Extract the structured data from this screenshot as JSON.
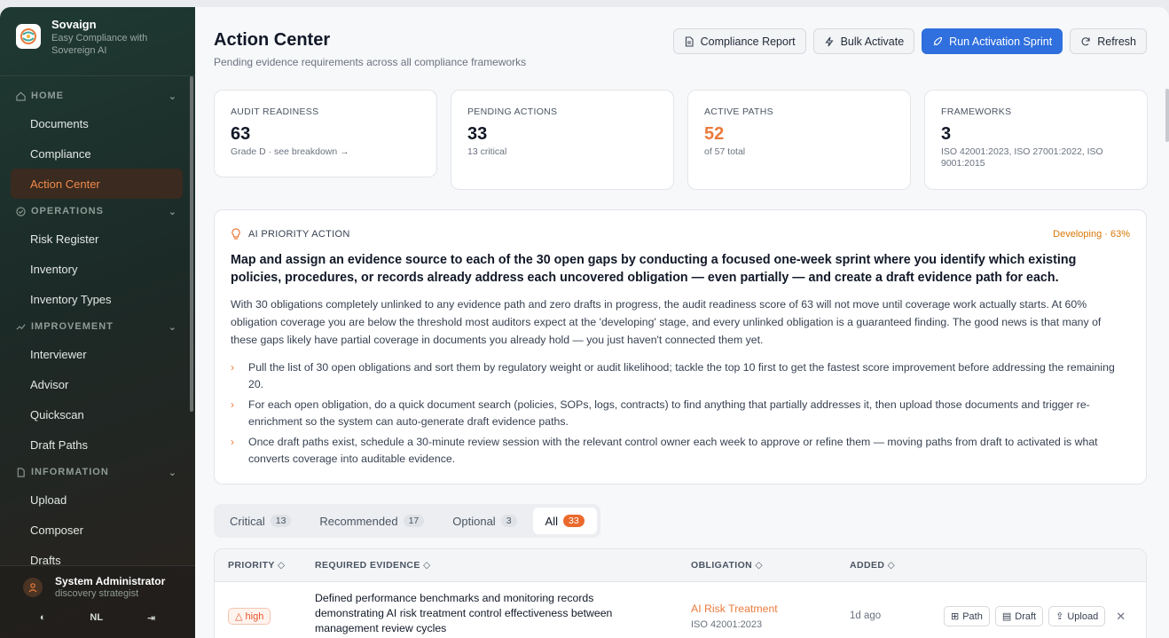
{
  "brand": {
    "name": "Sovaign",
    "tagline": "Easy Compliance with Sovereign AI"
  },
  "sidebar": {
    "sections": [
      {
        "label": "HOME",
        "icon": "home-icon",
        "items": [
          "Documents",
          "Compliance",
          "Action Center"
        ]
      },
      {
        "label": "OPERATIONS",
        "icon": "shield-check-icon",
        "items": [
          "Risk Register",
          "Inventory",
          "Inventory Types"
        ]
      },
      {
        "label": "IMPROVEMENT",
        "icon": "trend-icon",
        "items": [
          "Interviewer",
          "Advisor",
          "Quickscan",
          "Draft Paths"
        ]
      },
      {
        "label": "INFORMATION",
        "icon": "file-icon",
        "items": [
          "Upload",
          "Composer",
          "Drafts"
        ]
      }
    ],
    "active_item": "Action Center",
    "user": {
      "name": "System Administrator",
      "role": "discovery strategist"
    },
    "language": "NL"
  },
  "header": {
    "title": "Action Center",
    "subtitle": "Pending evidence requirements across all compliance frameworks"
  },
  "actions": {
    "report": "Compliance Report",
    "bulk": "Bulk Activate",
    "sprint": "Run Activation Sprint",
    "refresh": "Refresh"
  },
  "stats": [
    {
      "label": "AUDIT READINESS",
      "value": "63",
      "sub": "Grade D · see breakdown →"
    },
    {
      "label": "PENDING ACTIONS",
      "value": "33",
      "sub": "13 critical"
    },
    {
      "label": "ACTIVE PATHS",
      "value": "52",
      "sub": "of 57 total"
    },
    {
      "label": "FRAMEWORKS",
      "value": "3",
      "sub": "ISO 42001:2023, ISO 27001:2022, ISO 9001:2015"
    }
  ],
  "priority": {
    "label": "AI PRIORITY ACTION",
    "status": "Developing · 63%",
    "headline": "Map and assign an evidence source to each of the 30 open gaps by conducting a focused one-week sprint where you identify which existing policies, procedures, or records already address each uncovered obligation — even partially — and create a draft evidence path for each.",
    "body": "With 30 obligations completely unlinked to any evidence path and zero drafts in progress, the audit readiness score of 63 will not move until coverage work actually starts. At 60% obligation coverage you are below the threshold most auditors expect at the 'developing' stage, and every unlinked obligation is a guaranteed finding. The good news is that many of these gaps likely have partial coverage in documents you already hold — you just haven't connected them yet.",
    "steps": [
      "Pull the list of 30 open obligations and sort them by regulatory weight or audit likelihood; tackle the top 10 first to get the fastest score improvement before addressing the remaining 20.",
      "For each open obligation, do a quick document search (policies, SOPs, logs, contracts) to find anything that partially addresses it, then upload those documents and trigger re-enrichment so the system can auto-generate draft evidence paths.",
      "Once draft paths exist, schedule a 30-minute review session with the relevant control owner each week to approve or refine them — moving paths from draft to activated is what converts coverage into auditable evidence."
    ]
  },
  "tabs": [
    {
      "label": "Critical",
      "count": "13"
    },
    {
      "label": "Recommended",
      "count": "17"
    },
    {
      "label": "Optional",
      "count": "3"
    },
    {
      "label": "All",
      "count": "33"
    }
  ],
  "table": {
    "headers": {
      "priority": "PRIORITY",
      "evidence": "REQUIRED EVIDENCE",
      "obligation": "OBLIGATION",
      "added": "ADDED"
    },
    "rows": [
      {
        "priority": "high",
        "evidence": "Defined performance benchmarks and monitoring records demonstrating AI risk treatment control effectiveness between management review cycles",
        "obligation": "AI Risk Treatment",
        "framework": "ISO 42001:2023",
        "added": "1d ago",
        "actions": {
          "path": "Path",
          "draft": "Draft",
          "upload": "Upload"
        }
      }
    ]
  },
  "colors": {
    "accent": "#ea7b3c",
    "primary": "#2f6fde",
    "status_developing": "#d97706"
  }
}
